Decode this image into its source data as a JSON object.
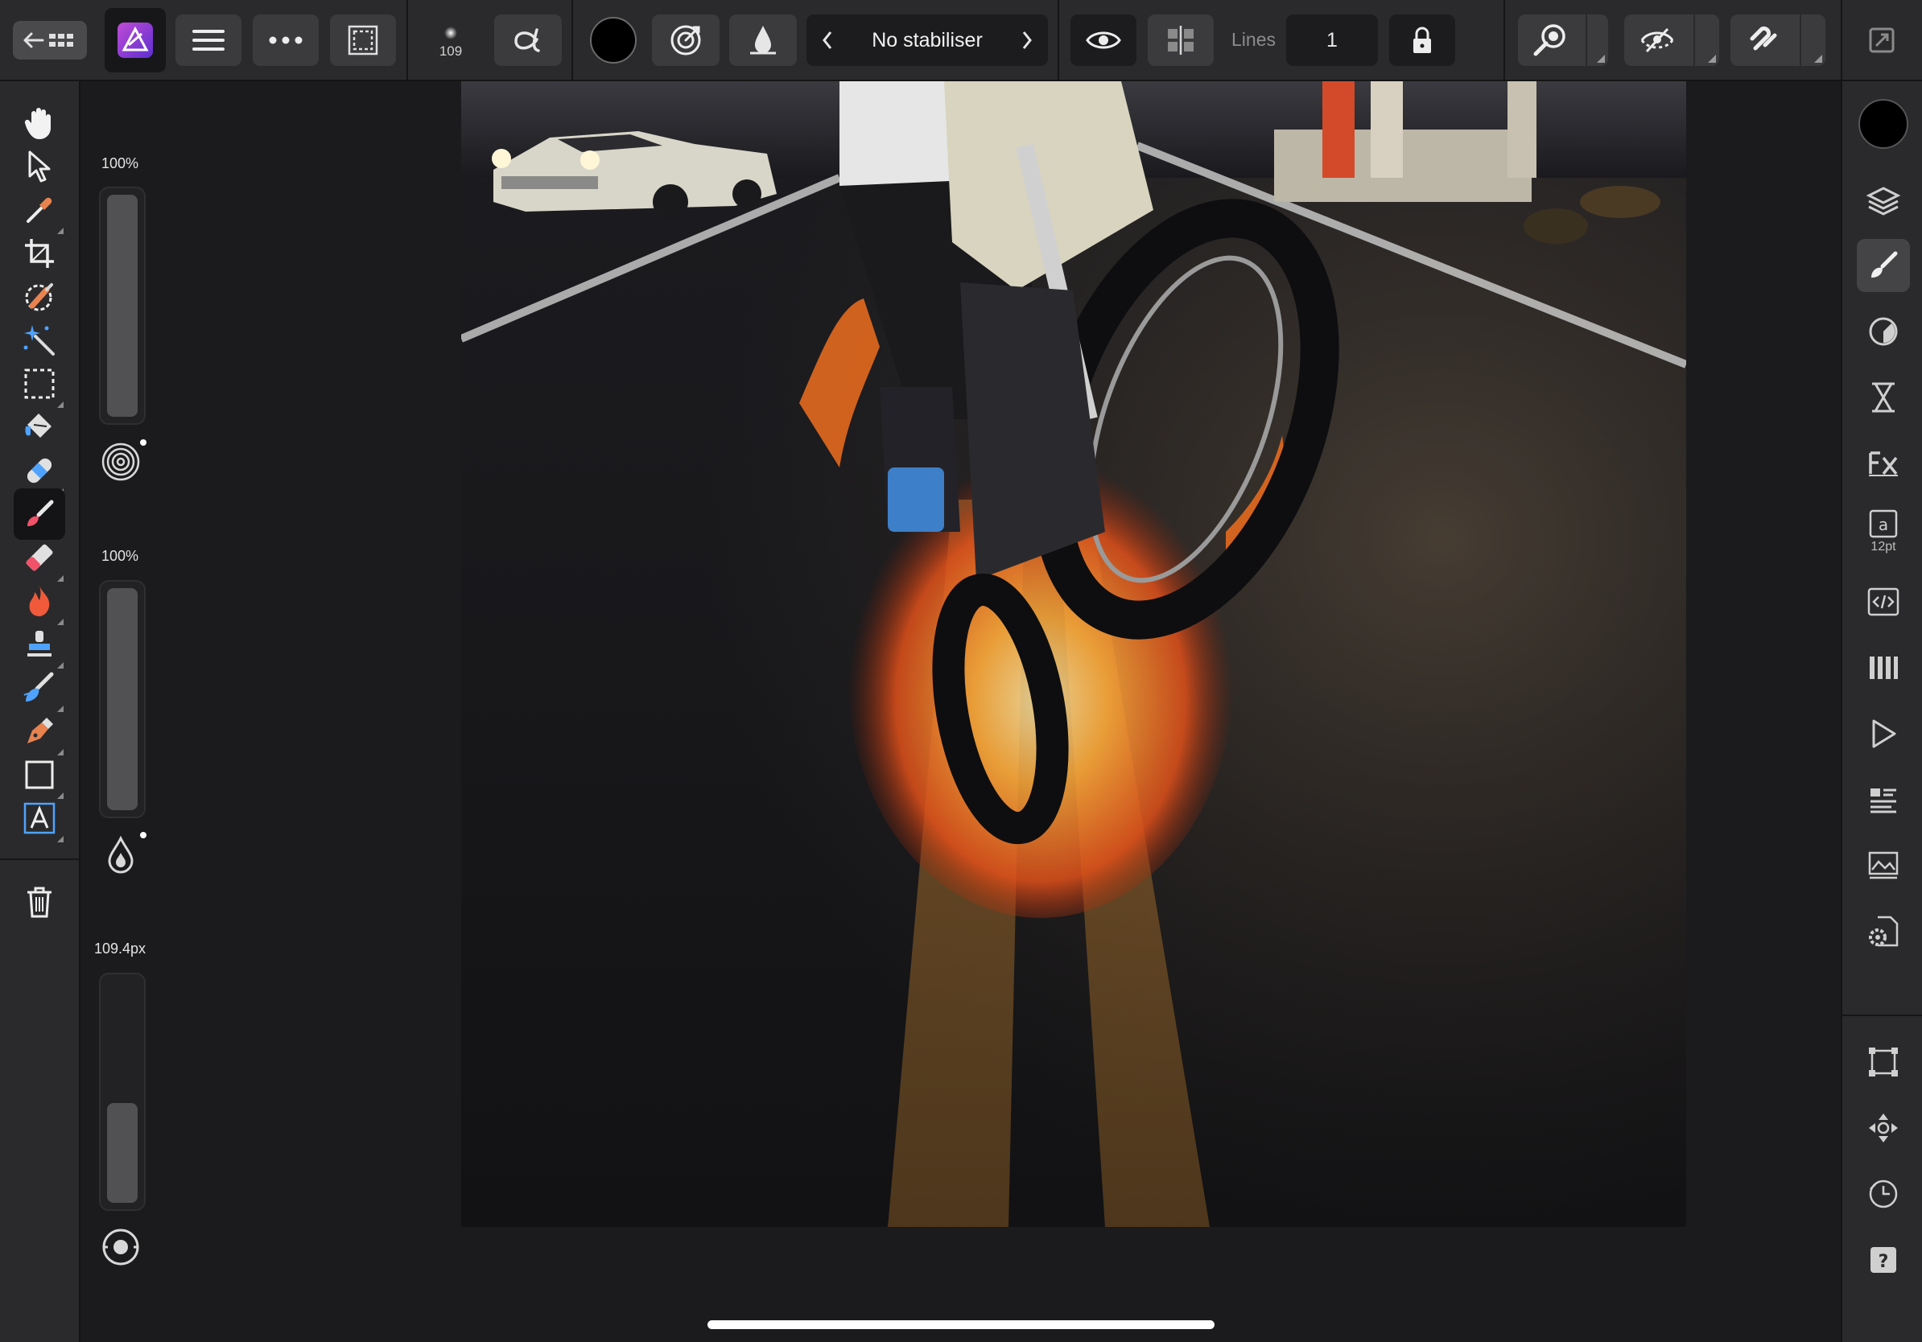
{
  "toolbar": {
    "home_button_icon": "back-grid-icon",
    "app_icon": "affinity-photo-icon",
    "menu_icon": "hamburger-icon",
    "more_icon": "ellipsis-icon",
    "selection_icon": "marquee-icon",
    "brush_size_value": "109",
    "brush_alpha_icon": "alpha-icon",
    "colour_swatch": "#000000",
    "stabiliser": {
      "prev_icon": "chevron-left-icon",
      "label": "No stabiliser",
      "next_icon": "chevron-right-icon"
    },
    "lines_label": "Lines",
    "lines_value": "1",
    "lock_icon": "lock-icon",
    "magnifier_icon": "loupe-icon",
    "view_icon": "hidden-eye-icon",
    "snapping_icon": "magnet-icon",
    "fullscreen_icon": "expand-icon"
  },
  "left_tools": [
    {
      "name": "hand-tool",
      "icon": "hand-icon"
    },
    {
      "name": "move-tool",
      "icon": "arrow-cursor-icon"
    },
    {
      "name": "colour-picker-tool",
      "icon": "eyedropper-icon"
    },
    {
      "name": "crop-tool",
      "icon": "crop-icon"
    },
    {
      "name": "selection-brush-tool",
      "icon": "selection-brush-icon"
    },
    {
      "name": "flood-select-tool",
      "icon": "magic-wand-icon"
    },
    {
      "name": "marquee-tool",
      "icon": "marquee-icon"
    },
    {
      "name": "flood-fill-tool",
      "icon": "paint-bucket-icon"
    },
    {
      "name": "healing-tool",
      "icon": "bandage-icon"
    },
    {
      "name": "paint-brush-tool",
      "icon": "paint-brush-icon",
      "active": true
    },
    {
      "name": "erase-brush-tool",
      "icon": "eraser-icon"
    },
    {
      "name": "burn-brush-tool",
      "icon": "flame-icon"
    },
    {
      "name": "clone-brush-tool",
      "icon": "stamp-icon"
    },
    {
      "name": "smudge-brush-tool",
      "icon": "smudge-icon"
    },
    {
      "name": "pen-tool",
      "icon": "pen-nib-icon"
    },
    {
      "name": "rectangle-tool",
      "icon": "rectangle-icon"
    },
    {
      "name": "text-tool",
      "icon": "text-frame-icon"
    },
    {
      "name": "delete-tool",
      "icon": "trash-icon"
    }
  ],
  "sliders": {
    "opacity": {
      "label": "100%",
      "value": 1.0,
      "icon": "spiral-icon"
    },
    "flow": {
      "label": "100%",
      "value": 1.0,
      "icon": "drop-icon"
    },
    "width": {
      "label": "109.4px",
      "value": 0.45,
      "icon": "circle-target-icon"
    }
  },
  "right_panels": [
    {
      "name": "colour-panel",
      "icon": "colour-disc-icon"
    },
    {
      "name": "layers-panel",
      "icon": "layers-icon"
    },
    {
      "name": "brushes-panel",
      "icon": "brush-panel-icon",
      "active": true
    },
    {
      "name": "adjustments-panel",
      "icon": "adjustment-icon"
    },
    {
      "name": "history-panel",
      "icon": "hourglass-icon"
    },
    {
      "name": "fx-panel",
      "icon": "fx-icon"
    },
    {
      "name": "character-panel",
      "icon": "text-a-icon",
      "sub": "12pt"
    },
    {
      "name": "macro-panel",
      "icon": "code-icon"
    },
    {
      "name": "channels-panel",
      "icon": "channels-icon"
    },
    {
      "name": "play-panel",
      "icon": "play-icon"
    },
    {
      "name": "info-panel",
      "icon": "list-icon"
    },
    {
      "name": "stock-panel",
      "icon": "stock-icon"
    },
    {
      "name": "document-settings-panel",
      "icon": "document-gear-icon"
    },
    {
      "name": "transform-panel",
      "icon": "transform-icon"
    },
    {
      "name": "navigator-panel",
      "icon": "move-arrows-icon"
    },
    {
      "name": "timer-panel",
      "icon": "clock-icon"
    },
    {
      "name": "help-panel",
      "icon": "help-icon"
    }
  ],
  "canvas": {
    "content": "photo-artwork"
  }
}
